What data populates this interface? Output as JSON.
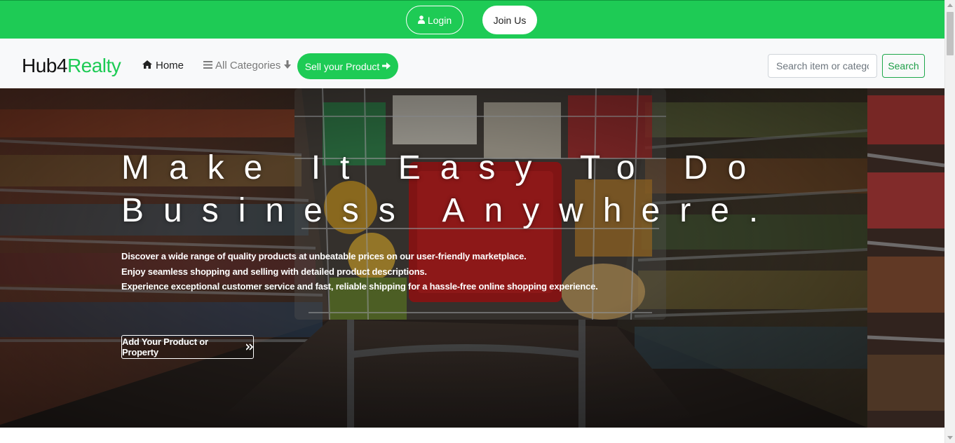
{
  "topbar": {
    "login_label": "Login",
    "join_label": "Join Us",
    "login_icon": "user-icon",
    "bg_color": "#1ecb55"
  },
  "navbar": {
    "brand_prefix": "Hub4",
    "brand_accent": "Realty",
    "home_label": "Home",
    "home_icon": "home-icon",
    "categories_label": "All Categories",
    "categories_icon": "menu-icon",
    "categories_arrow_icon": "arrow-down-icon",
    "sell_label": "Sell your Product",
    "sell_icon": "arrow-right-icon",
    "search_placeholder": "Search item or category",
    "search_button_label": "Search",
    "accent_color": "#1ecb55"
  },
  "hero": {
    "title_line1": "Make It Easy To Do",
    "title_line2": "Business Anywhere.",
    "desc_lines": [
      "Discover a wide range of quality products at unbeatable prices on our user-friendly marketplace.",
      "Enjoy seamless shopping and selling with detailed product descriptions.",
      "Experience exceptional customer service and fast, reliable shipping for a hassle-free online shopping experience."
    ],
    "cta_label": "Add Your Product or Property",
    "cta_icon": "double-chevron-right-icon"
  }
}
